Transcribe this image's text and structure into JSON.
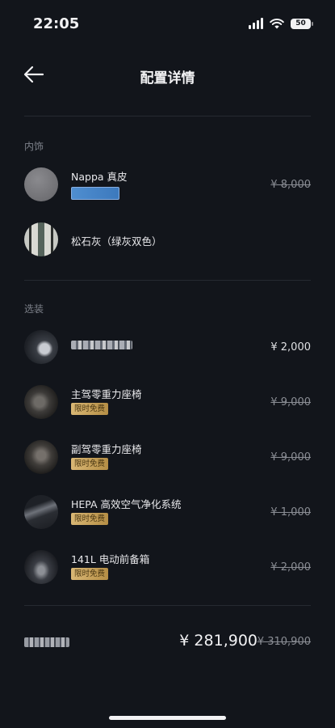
{
  "status_bar": {
    "time": "22:05",
    "battery": "50"
  },
  "nav": {
    "title": "配置详情"
  },
  "interior": {
    "label": "内饰",
    "items": [
      {
        "name": "Nappa 真皮",
        "price": "¥ 8,000",
        "price_struck": true,
        "thumb_icon": "grey-leather-swatch"
      },
      {
        "name": "松石灰（绿灰双色）",
        "price": "",
        "thumb_icon": "striped-color-swatch"
      }
    ]
  },
  "options": {
    "label": "选装",
    "items": [
      {
        "name": "",
        "price": "¥ 2,000",
        "price_struck": false,
        "thumb_icon": "accessory-photo"
      },
      {
        "name": "主驾零重力座椅",
        "tag": "限时免费",
        "price": "¥ 9,000",
        "price_struck": true,
        "thumb_icon": "seat-photo"
      },
      {
        "name": "副驾零重力座椅",
        "tag": "限时免费",
        "price": "¥ 9,000",
        "price_struck": true,
        "thumb_icon": "seat-photo"
      },
      {
        "name": "HEPA 高效空气净化系统",
        "tag": "限时免费",
        "price": "¥ 1,000",
        "price_struck": true,
        "thumb_icon": "air-filter-photo"
      },
      {
        "name": "141L 电动前备箱",
        "tag": "限时免费",
        "price": "¥ 2,000",
        "price_struck": true,
        "thumb_icon": "car-front-trunk-photo"
      }
    ]
  },
  "total": {
    "price": "¥ 281,900",
    "original": "¥ 310,900"
  },
  "colors": {
    "background": "#12151b",
    "tag_gold": "#d9b775",
    "accent_blue": "#4f8ed0"
  }
}
